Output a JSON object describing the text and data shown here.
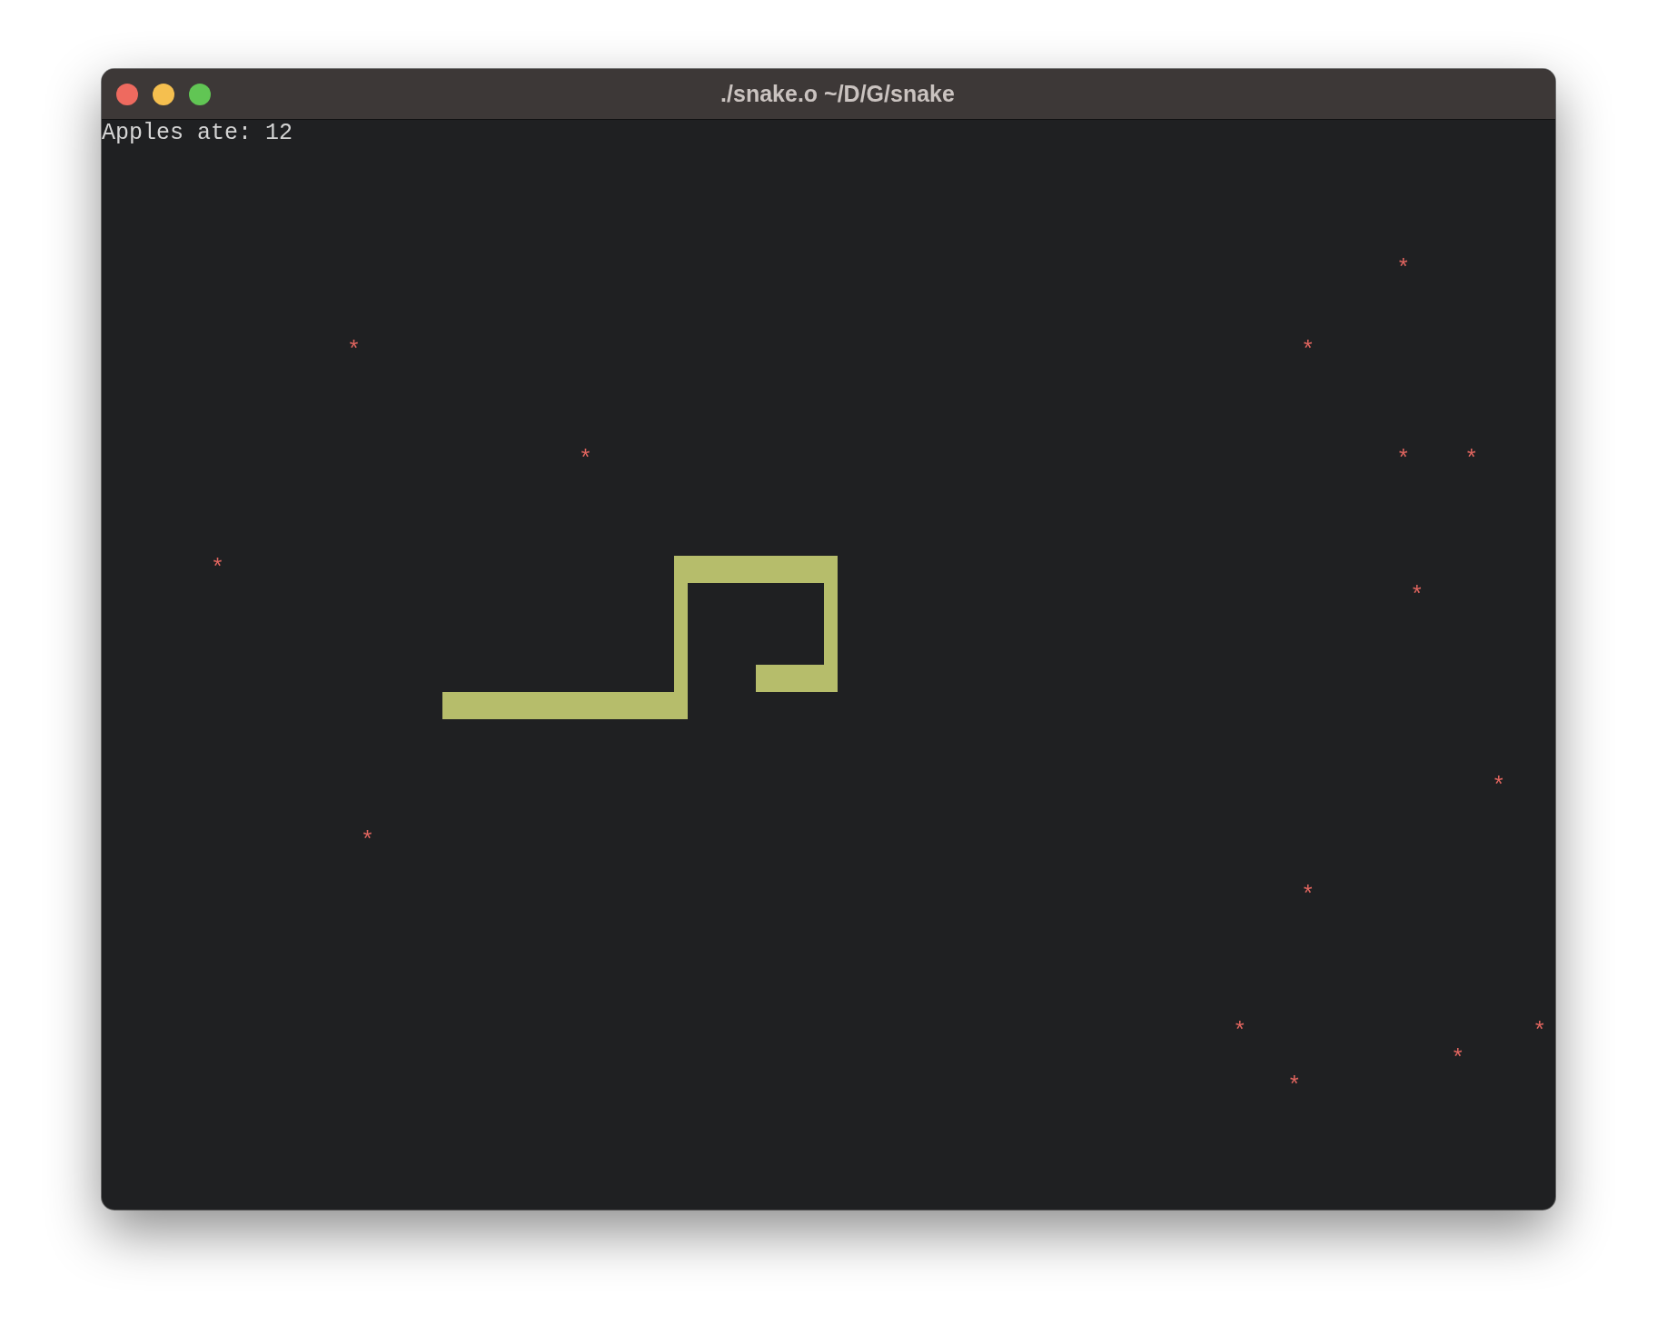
{
  "window": {
    "title": "./snake.o ~/D/G/snake"
  },
  "terminal": {
    "status": "Apples ate: 12",
    "apple_rows": [
      "\n\n\n\n                                                                                               *",
      "\n\n                  *                                                                     *",
      "\n\n\n                                   *                                                           *    *",
      "\n\n\n        *",
      "                                                                                                *",
      "\n\n\n\n\n\n                                                                                                      *",
      "\n                   *",
      "\n                                                                                        *",
      "\n\n\n\n                                                                                   *                     *",
      "                                                                                                   *",
      "                                                                                       *"
    ]
  }
}
